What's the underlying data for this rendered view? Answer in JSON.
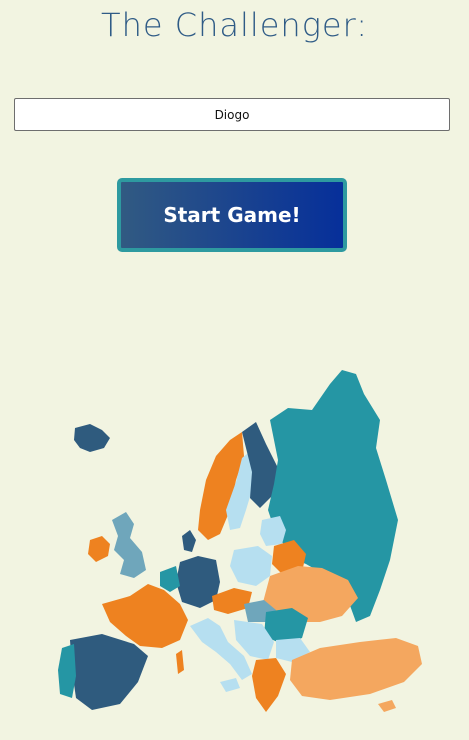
{
  "title": "The Challenger:",
  "player": {
    "name_value": "Diogo"
  },
  "start_button": {
    "label": "Start Game!"
  },
  "colors": {
    "background": "#f2f4e1",
    "title": "#2f5b86",
    "button_gradient_start": "#315a82",
    "button_gradient_end": "#062f9a",
    "button_border": "#2e9aa0",
    "map_dark_blue": "#2f5b7e",
    "map_teal": "#2596a4",
    "map_orange": "#ee8220",
    "map_light_orange": "#f4a75f",
    "map_light_blue": "#b6dff0",
    "map_steel_blue": "#6fa6bb"
  }
}
